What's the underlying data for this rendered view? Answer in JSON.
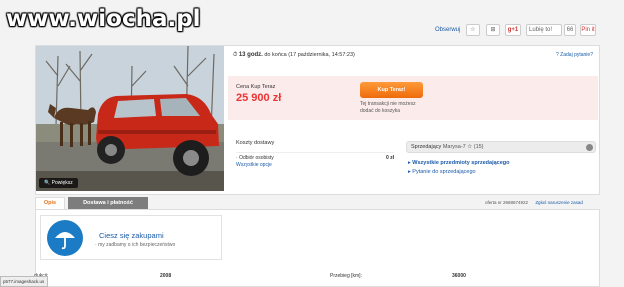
{
  "logo": "www.wiocha.pl",
  "topbar": {
    "observe": "Obserwuj",
    "like": "Lubię to!",
    "like_count": "66",
    "pin": "Pin it",
    "gplus": "g+1"
  },
  "photo": {
    "zoom_label": "Powiększ"
  },
  "auction": {
    "end_bold": "13 godz.",
    "end_rest": " do końca (17 października, 14:57:23)",
    "ask_question": "Zadaj pytanie?"
  },
  "price": {
    "label": "Cena Kup Teraz",
    "value": "25 900 zł",
    "buy_button": "Kup Teraz!",
    "note_line1": "Tej transakcji nie możesz",
    "note_line2": "dodać do koszyka"
  },
  "shipping": {
    "title": "Koszty dostawy",
    "rows": [
      {
        "label": "Odbiór osobisty",
        "value": "0 zł"
      }
    ],
    "all_options": "Wszystkie opcje"
  },
  "seller": {
    "label": "Sprzedający",
    "name": "Marysa-7",
    "rating": "(15)",
    "links": [
      "Wszystkie przedmioty sprzedającego",
      "Pytanie do sprzedającego"
    ]
  },
  "tabs": [
    "Opis",
    "Dostawa i płatność"
  ],
  "offer": {
    "number": "oferta nr 2668674922",
    "report": "Zgłoś naruszenie zasad"
  },
  "safe": {
    "title": "Ciesz się zakupami",
    "subtitle": "my zadbamy o ich bezpieczeństwo"
  },
  "details": [
    {
      "label": "...dukcji:",
      "value": "2008"
    },
    {
      "label": "Przebieg [km]:",
      "value": "36000"
    }
  ],
  "statusbar": "p577.imageshack.us"
}
